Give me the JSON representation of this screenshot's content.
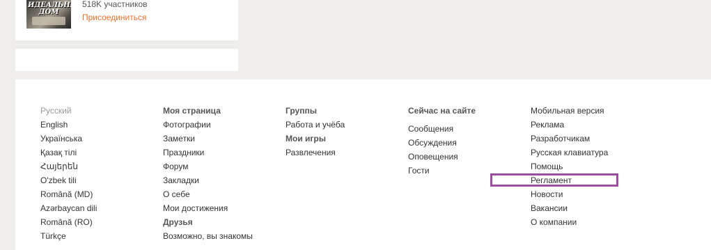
{
  "group_card": {
    "thumbnail_text": "ИДЕАЛЬНЫЙ ДОМ",
    "members": "518K участников",
    "join_label": "Присоединиться"
  },
  "footer": {
    "languages": [
      "Русский",
      "English",
      "Українська",
      "Қазақ тілі",
      "Հայերեն",
      "O'zbek tili",
      "Română (MD)",
      "Azərbaycan dili",
      "Română (RO)",
      "Türkçe"
    ],
    "my_page": {
      "heading": "Моя страница",
      "items": [
        "Фотографии",
        "Заметки",
        "Праздники",
        "Форум",
        "Закладки",
        "О себе",
        "Мои достижения"
      ],
      "friends_heading": "Друзья",
      "friends_items": [
        "Возможно, вы знакомы"
      ]
    },
    "groups": {
      "heading": "Группы",
      "items": [
        "Работа и учёба"
      ],
      "games_heading": "Мои игры",
      "games_items": [
        "Развлечения"
      ]
    },
    "now_on_site": {
      "heading": "Сейчас на сайте",
      "items": [
        "Сообщения",
        "Обсуждения",
        "Оповещения",
        "Гости"
      ]
    },
    "misc": {
      "items": [
        "Мобильная версия",
        "Реклама",
        "Разработчикам",
        "Русская клавиатура",
        "Помощь",
        "Регламент",
        "Новости",
        "Вакансии",
        "О компании"
      ]
    }
  },
  "colors": {
    "accent": "#eb722e",
    "highlight": "#9b4f9e",
    "background": "#efeeeb"
  }
}
